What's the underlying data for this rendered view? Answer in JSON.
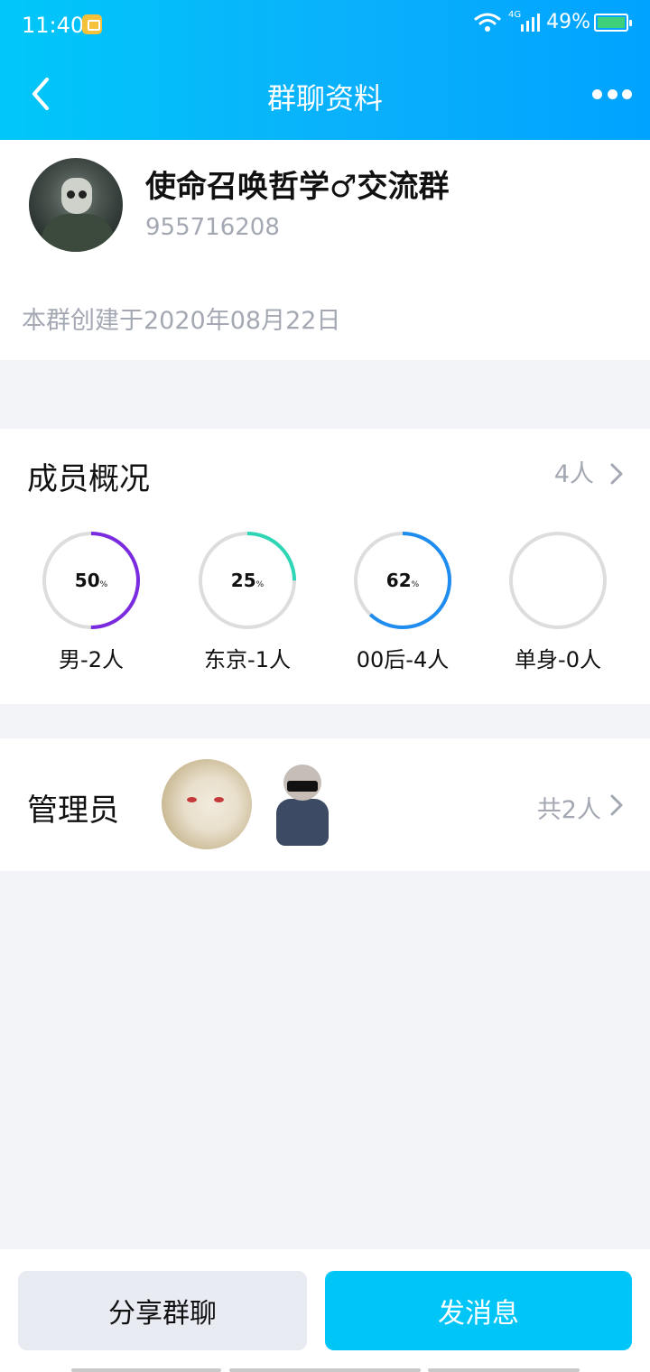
{
  "status_bar": {
    "time": "11:40",
    "network": "4G",
    "battery": "49%"
  },
  "header": {
    "title": "群聊资料"
  },
  "group": {
    "name": "使命召唤哲学♂交流群",
    "id": "955716208",
    "created": "本群创建于2020年08月22日"
  },
  "members": {
    "title": "成员概况",
    "count": "4人",
    "stats": [
      {
        "value": "50",
        "unit": "%",
        "label": "男-2人",
        "fraction": 0.5,
        "color": "#7a2be0"
      },
      {
        "value": "25",
        "unit": "%",
        "label": "东京-1人",
        "fraction": 0.25,
        "color": "#2fd6b6"
      },
      {
        "value": "62",
        "unit": "%",
        "label": "00后-4人",
        "fraction": 0.62,
        "color": "#1f8cf0"
      },
      {
        "value": "",
        "unit": "",
        "label": "单身-0人",
        "fraction": 0,
        "color": "#dddddd"
      }
    ]
  },
  "admins": {
    "title": "管理员",
    "count": "共2人"
  },
  "bottom": {
    "share_label": "分享群聊",
    "send_label": "发消息"
  },
  "colors": {
    "header_start": "#00c7f9",
    "header_end": "#00a3ff",
    "send_button": "#00c6f8",
    "ring_track": "#dddddd"
  }
}
